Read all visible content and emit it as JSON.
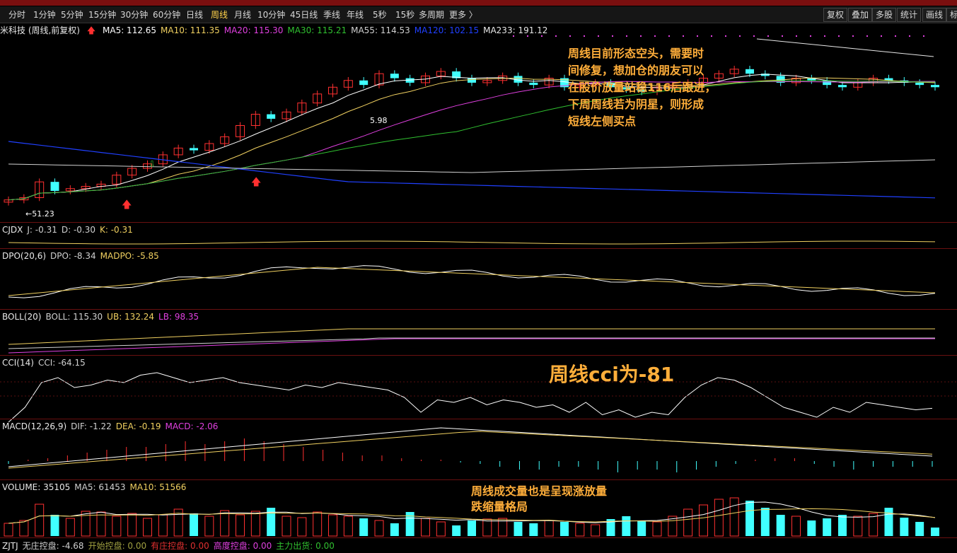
{
  "top_menu": {
    "items": []
  },
  "period_bar": {
    "items": [
      "分时",
      "1分钟",
      "5分钟",
      "15分钟",
      "30分钟",
      "60分钟",
      "日线",
      "周线",
      "月线",
      "10分钟",
      "45日线",
      "季线",
      "年线",
      "5秒",
      "15秒",
      "多周期",
      "更多 〉"
    ],
    "active": "周线"
  },
  "tools": [
    "复权",
    "叠加",
    "多股",
    "统计",
    "画线",
    "标"
  ],
  "main": {
    "stock_label": "米科技 (周线,前复权)",
    "ma": [
      {
        "label": "MA5: 112.65",
        "color": "#ffffff"
      },
      {
        "label": "MA10: 111.35",
        "color": "#f0d060"
      },
      {
        "label": "MA20: 115.30",
        "color": "#e040e0"
      },
      {
        "label": "MA30: 115.21",
        "color": "#30c030"
      },
      {
        "label": "MA55: 114.53",
        "color": "#d0d0d0"
      },
      {
        "label": "MA120: 102.15",
        "color": "#2040ff"
      },
      {
        "label": "MA233: 191.12",
        "color": "#e8e8e8"
      }
    ],
    "low_label": "51.23",
    "high_label": "5.98"
  },
  "indicators": {
    "cjdx": {
      "name": "CJDX",
      "items": [
        {
          "t": "J: -0.31",
          "c": "#d0d0d0"
        },
        {
          "t": "D: -0.30",
          "c": "#d0d0d0"
        },
        {
          "t": "K: -0.31",
          "c": "#f0d060"
        }
      ]
    },
    "dpo": {
      "name": "DPO(20,6)",
      "items": [
        {
          "t": "DPO: -8.34",
          "c": "#d0d0d0"
        },
        {
          "t": "MADPO: -5.85",
          "c": "#f0d060"
        }
      ]
    },
    "boll": {
      "name": "BOLL(20)",
      "items": [
        {
          "t": "BOLL: 115.30",
          "c": "#d0d0d0"
        },
        {
          "t": "UB: 132.24",
          "c": "#f0d060"
        },
        {
          "t": "LB: 98.35",
          "c": "#e040e0"
        }
      ]
    },
    "cci": {
      "name": "CCI(14)",
      "items": [
        {
          "t": "CCI: -64.15",
          "c": "#d0d0d0"
        }
      ]
    },
    "macd": {
      "name": "MACD(12,26,9)",
      "items": [
        {
          "t": "DIF: -1.22",
          "c": "#d0d0d0"
        },
        {
          "t": "DEA: -0.19",
          "c": "#f0d060"
        },
        {
          "t": "MACD: -2.06",
          "c": "#e040e0"
        }
      ]
    },
    "volume": {
      "name": "VOLUME: 35105",
      "items": [
        {
          "t": "MA5: 61453",
          "c": "#d0d0d0"
        },
        {
          "t": "MA10: 51566",
          "c": "#f0d060"
        }
      ]
    },
    "zjtj": {
      "name": "ZJTJ",
      "items": [
        {
          "t": "无庄控盘: -4.68",
          "c": "#d0d0d0"
        },
        {
          "t": "开始控盘: 0.00",
          "c": "#a0a040"
        },
        {
          "t": "有庄控盘: 0.00",
          "c": "#e03030"
        },
        {
          "t": "高度控盘: 0.00",
          "c": "#e040e0"
        },
        {
          "t": "主力出货: 0.00",
          "c": "#30c030"
        }
      ]
    }
  },
  "notes": {
    "note1": "周线目前形态空头，需要时\n间修复，想加仓的朋友可以\n在股价放量站稳116后跟进，\n下周周线若为阴星，则形成\n短线左侧买点",
    "note2": "周线cci为-81",
    "note3": "周线成交量也是呈现涨放量\n跌缩量格局"
  },
  "colors": {
    "up": "#ff3030",
    "down": "#40ffff",
    "bg": "#000000",
    "accent": "#ffd24a",
    "note": "#ffae3a"
  },
  "chart_data": {
    "type": "candlestick",
    "closes": [
      52,
      53,
      60,
      56,
      57,
      58,
      59,
      63,
      66,
      68,
      72,
      75,
      74,
      77,
      80,
      85,
      90,
      88,
      91,
      95,
      99,
      102,
      105,
      103,
      108,
      106,
      104,
      107,
      109,
      106,
      104,
      105,
      107,
      104,
      103,
      106,
      102,
      103,
      104,
      102,
      101,
      100,
      102,
      103,
      104,
      106,
      108,
      110,
      108,
      107,
      104,
      106,
      105,
      103,
      102,
      104,
      106,
      105,
      104,
      103,
      102
    ],
    "volume": [
      18,
      22,
      45,
      30,
      25,
      35,
      34,
      28,
      32,
      25,
      30,
      38,
      32,
      28,
      36,
      30,
      35,
      40,
      28,
      26,
      34,
      30,
      28,
      25,
      22,
      18,
      34,
      25,
      20,
      15,
      22,
      24,
      25,
      20,
      18,
      22,
      20,
      18,
      16,
      24,
      28,
      22,
      20,
      28,
      38,
      44,
      52,
      54,
      50,
      40,
      30,
      28,
      22,
      25,
      30,
      28,
      32,
      40,
      26,
      20,
      12
    ],
    "cci": [
      -120,
      -60,
      40,
      60,
      20,
      30,
      50,
      40,
      70,
      80,
      60,
      40,
      50,
      60,
      40,
      30,
      20,
      10,
      30,
      20,
      40,
      30,
      20,
      10,
      -20,
      -80,
      -30,
      -40,
      -20,
      -50,
      -30,
      -40,
      -60,
      -50,
      -80,
      -40,
      -90,
      -70,
      -100,
      -80,
      -90,
      -20,
      30,
      60,
      50,
      20,
      -20,
      -60,
      -80,
      -100,
      -60,
      -80,
      -40,
      -50,
      -60,
      -70,
      -64
    ],
    "macd_hist": [
      -1,
      0.5,
      1,
      2,
      3,
      4,
      5,
      5,
      6,
      7,
      6,
      7,
      8,
      7,
      6,
      5,
      4,
      3,
      2,
      2,
      1,
      0.5,
      0.5,
      -0.5,
      -1,
      -2,
      -3,
      -3,
      -2,
      -2,
      -3,
      -4,
      -3,
      -3,
      -4,
      -3,
      -2,
      -1,
      0.5,
      1,
      1,
      -1,
      -2,
      -3,
      -2,
      -2,
      -2,
      -2
    ]
  }
}
